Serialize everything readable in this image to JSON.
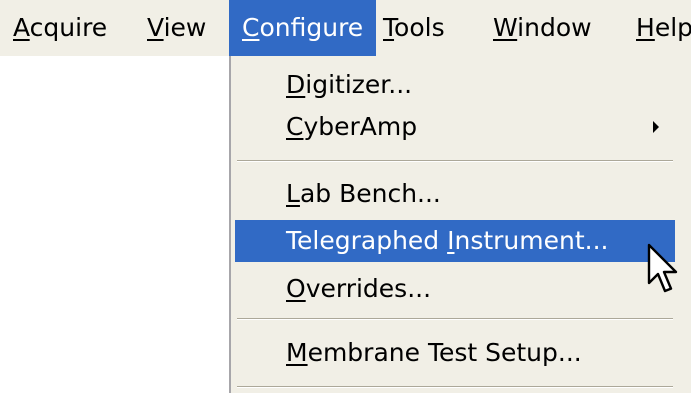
{
  "menubar": {
    "items": [
      {
        "mnemonic": "A",
        "rest": "cquire"
      },
      {
        "mnemonic": "V",
        "rest": "iew"
      },
      {
        "mnemonic": "C",
        "rest": "onfigure"
      },
      {
        "mnemonic": "T",
        "rest": "ools"
      },
      {
        "mnemonic": "W",
        "rest": "indow"
      },
      {
        "mnemonic": "H",
        "rest": "elp"
      }
    ],
    "active": "Configure"
  },
  "menu": {
    "digitizer": {
      "pre": "",
      "mnemonic": "D",
      "post": "igitizer..."
    },
    "cyberamp": {
      "pre": "",
      "mnemonic": "C",
      "post": "yberAmp"
    },
    "lab_bench": {
      "pre": "",
      "mnemonic": "L",
      "post": "ab Bench..."
    },
    "telegraphed": {
      "pre": "Telegraphed ",
      "mnemonic": "I",
      "post": "nstrument..."
    },
    "overrides": {
      "pre": "",
      "mnemonic": "O",
      "post": "verrides..."
    },
    "membrane": {
      "pre": "",
      "mnemonic": "M",
      "post": "embrane Test Setup..."
    }
  },
  "icons": {
    "submenu_arrow": "triangle-right-icon",
    "cursor": "mouse-pointer-icon"
  },
  "colors": {
    "highlight": "#316ac5",
    "menu_background": "#f1efe6"
  }
}
